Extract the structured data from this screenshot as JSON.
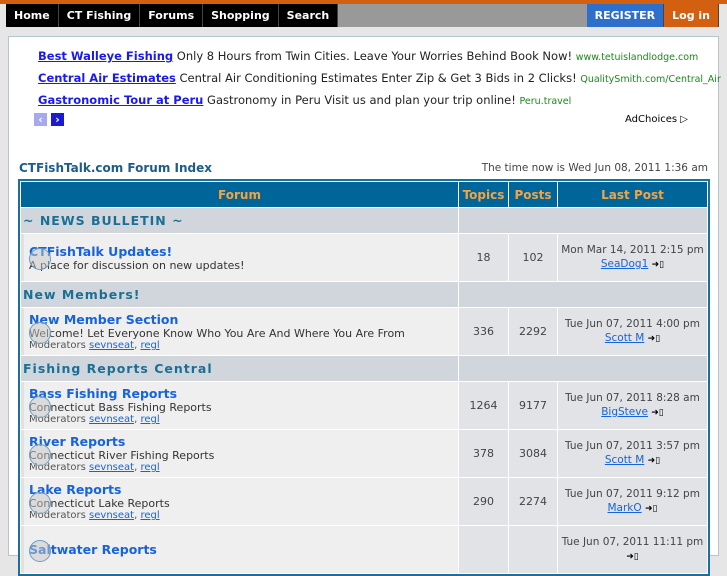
{
  "nav": {
    "items": [
      "Home",
      "CT Fishing",
      "Forums",
      "Shopping",
      "Search"
    ],
    "register": "REGISTER",
    "login": "Log in"
  },
  "ads": [
    {
      "title": "Best Walleye Fishing",
      "text": "Only 8 Hours from Twin Cities. Leave Your Worries Behind Book Now!",
      "url": "www.tetuislandlodge.com"
    },
    {
      "title": "Central Air Estimates",
      "text": "Central Air Conditioning Estimates Enter Zip & Get 3 Bids in 2 Clicks!",
      "url": "QualitySmith.com/Central_Air"
    },
    {
      "title": "Gastronomic Tour at Peru",
      "text": "Gastronomy in Peru Visit us and plan your trip online!",
      "url": "Peru.travel"
    }
  ],
  "adchoices": "AdChoices",
  "index_title": "CTFishTalk.com Forum Index",
  "time_now": "The time now is Wed Jun 08, 2011 1:36 am",
  "table": {
    "headers": [
      "Forum",
      "Topics",
      "Posts",
      "Last Post"
    ],
    "mod_label": "Moderators",
    "rows": [
      {
        "cat": "~ NEWS BULLETIN ~"
      },
      {
        "name": "CTFishTalk Updates!",
        "desc": "A place for discussion on new updates!",
        "topics": "18",
        "posts": "102",
        "date": "Mon Mar 14, 2011 2:15 pm",
        "user": "SeaDog1"
      },
      {
        "cat": "New Members!"
      },
      {
        "name": "New Member Section",
        "desc": "Welcome! Let Everyone Know Who You Are And Where You Are From",
        "mods": [
          "sevnseat",
          "regl"
        ],
        "topics": "336",
        "posts": "2292",
        "date": "Tue Jun 07, 2011 4:00 pm",
        "user": "Scott M"
      },
      {
        "cat": "Fishing Reports Central"
      },
      {
        "name": "Bass Fishing Reports",
        "desc": "Connecticut Bass Fishing Reports",
        "mods": [
          "sevnseat",
          "regl"
        ],
        "topics": "1264",
        "posts": "9177",
        "date": "Tue Jun 07, 2011 8:28 am",
        "user": "BigSteve"
      },
      {
        "name": "River Reports",
        "desc": "Connecticut River Fishing Reports",
        "mods": [
          "sevnseat",
          "regl"
        ],
        "topics": "378",
        "posts": "3084",
        "date": "Tue Jun 07, 2011 3:57 pm",
        "user": "Scott M"
      },
      {
        "name": "Lake Reports",
        "desc": "Connecticut Lake Reports",
        "mods": [
          "sevnseat",
          "regl"
        ],
        "topics": "290",
        "posts": "2274",
        "date": "Tue Jun 07, 2011 9:12 pm",
        "user": "MarkO"
      },
      {
        "name": "Saltwater Reports",
        "desc": "",
        "topics": "",
        "posts": "",
        "date": "Tue Jun 07, 2011 11:11 pm",
        "user": ""
      }
    ]
  }
}
